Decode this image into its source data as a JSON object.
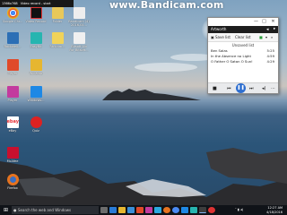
{
  "recorder": {
    "resolution": "1366x768",
    "status": "Video record - start",
    "watermark": "www.Bandicam.com"
  },
  "desktop_icons": [
    {
      "label": "Google Chr...",
      "color": "#e8e8e8"
    },
    {
      "label": "Video Record",
      "color": "#d33"
    },
    {
      "label": "Folder",
      "color": "#e8c85a"
    },
    {
      "label": "Bandicam (4) 2016-04...",
      "color": "#eeeeee"
    },
    {
      "label": "Rockwell...",
      "color": "#2c6fb5"
    },
    {
      "label": "EasyBit",
      "color": "#27b5b0"
    },
    {
      "label": "Rhythm...",
      "color": "#f0d35a"
    },
    {
      "label": "Bitsoft Lib For Bitsoft...",
      "color": "#f0f0f0"
    },
    {
      "label": "Player",
      "color": "#e04a2a"
    },
    {
      "label": "Winamp",
      "color": "#e6b630"
    },
    {
      "label": "Player",
      "color": "#c33a9e"
    },
    {
      "label": "Windows...",
      "color": "#1e88e5"
    },
    {
      "label": "eBay",
      "color": "#ffffff"
    },
    {
      "label": "Quiz",
      "color": "#d22"
    },
    {
      "label": "McAfee",
      "color": "#c8102e"
    },
    {
      "label": "Firefox",
      "color": "#e6731f"
    }
  ],
  "player": {
    "title_buttons": [
      "—",
      "□",
      "✕"
    ],
    "header": "Artworth",
    "save_label": "Save list",
    "clear_label": "Clear list",
    "playlist_title": "Unsaved list",
    "tracks": [
      {
        "title": "Ben Salas",
        "duration": "5:25"
      },
      {
        "title": "In the Absence no Light",
        "duration": "4:59"
      },
      {
        "title": "O Father O Satan O Sun!",
        "duration": "4:29"
      }
    ]
  },
  "taskbar": {
    "search_placeholder": "Search the web and Windows",
    "time": "12:27 AM",
    "date": "4/18/2016"
  }
}
